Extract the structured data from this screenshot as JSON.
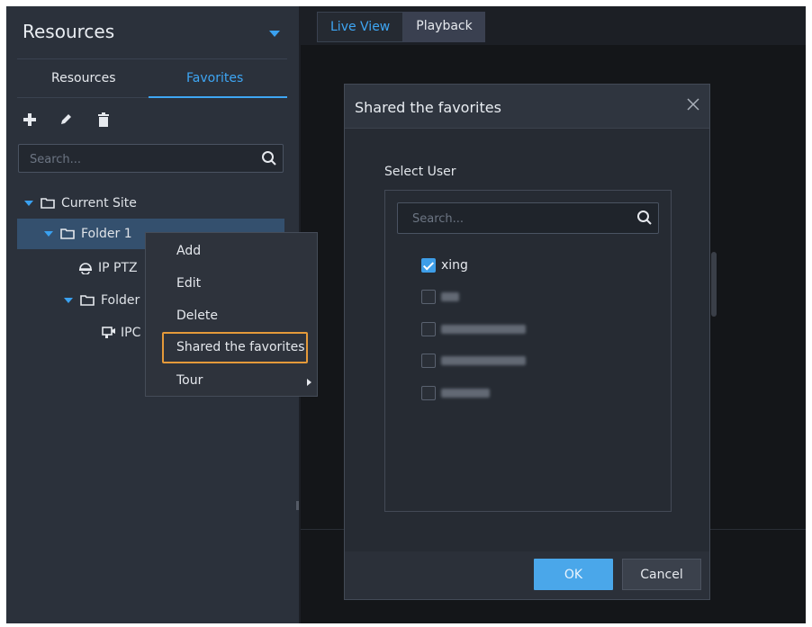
{
  "left_panel": {
    "title": "Resources",
    "tabs": [
      {
        "label": "Resources",
        "active": false
      },
      {
        "label": "Favorites",
        "active": true
      }
    ],
    "toolbar_icons": [
      "plus-icon",
      "pencil-icon",
      "trash-icon"
    ],
    "search_placeholder": "Search...",
    "tree": [
      {
        "label": "Current Site",
        "icon": "folder-icon",
        "expanded": true
      },
      {
        "label": "Folder 1",
        "icon": "folder-icon",
        "expanded": true,
        "selected": true
      },
      {
        "label": "IP PTZ",
        "icon": "ptz-camera-icon"
      },
      {
        "label": "Folder",
        "icon": "folder-icon",
        "expanded": true
      },
      {
        "label": "IPC",
        "icon": "ipc-camera-icon"
      }
    ]
  },
  "context_menu": {
    "items": [
      {
        "label": "Add"
      },
      {
        "label": "Edit"
      },
      {
        "label": "Delete"
      },
      {
        "label": "Shared the favorites",
        "highlighted": true
      },
      {
        "label": "Tour",
        "submenu": true
      }
    ]
  },
  "top_tabs": [
    {
      "label": "Live View",
      "active": true
    },
    {
      "label": "Playback",
      "active": false
    }
  ],
  "modal": {
    "title": "Shared the favorites",
    "select_label": "Select User",
    "search_placeholder": "Search...",
    "users": [
      {
        "name": "xing",
        "checked": true
      },
      {
        "name": "",
        "checked": false,
        "redacted": true
      },
      {
        "name": "",
        "checked": false,
        "redacted": true
      },
      {
        "name": "",
        "checked": false,
        "redacted": true
      },
      {
        "name": "",
        "checked": false,
        "redacted": true
      }
    ],
    "ok_label": "OK",
    "cancel_label": "Cancel"
  },
  "colors": {
    "accent": "#3ea6f4",
    "highlight_border": "#e59a3a",
    "panel_bg": "#2b313b",
    "ok_button": "#4aa7ea"
  }
}
